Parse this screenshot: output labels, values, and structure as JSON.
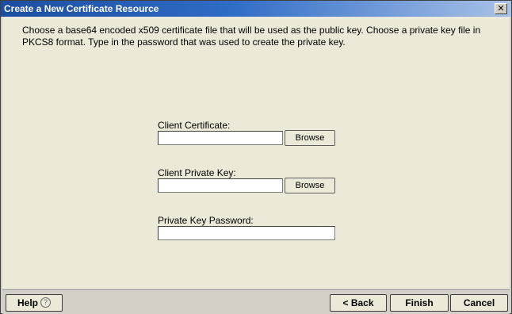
{
  "window": {
    "title": "Create a New Certificate Resource",
    "close_glyph": "✕"
  },
  "instructions": "Choose a base64 encoded x509 certificate file that will be used as the public key.  Choose a private key file in PKCS8 format.  Type in the password that was used to create the private key.",
  "form": {
    "client_certificate": {
      "label": "Client Certificate:",
      "value": "",
      "browse_label": "Browse"
    },
    "client_private_key": {
      "label": "Client Private Key:",
      "value": "",
      "browse_label": "Browse"
    },
    "private_key_password": {
      "label": "Private Key Password:",
      "value": ""
    }
  },
  "footer": {
    "help_label": "Help",
    "help_icon_glyph": "?",
    "back_label": "< Back",
    "finish_label": "Finish",
    "cancel_label": "Cancel"
  }
}
